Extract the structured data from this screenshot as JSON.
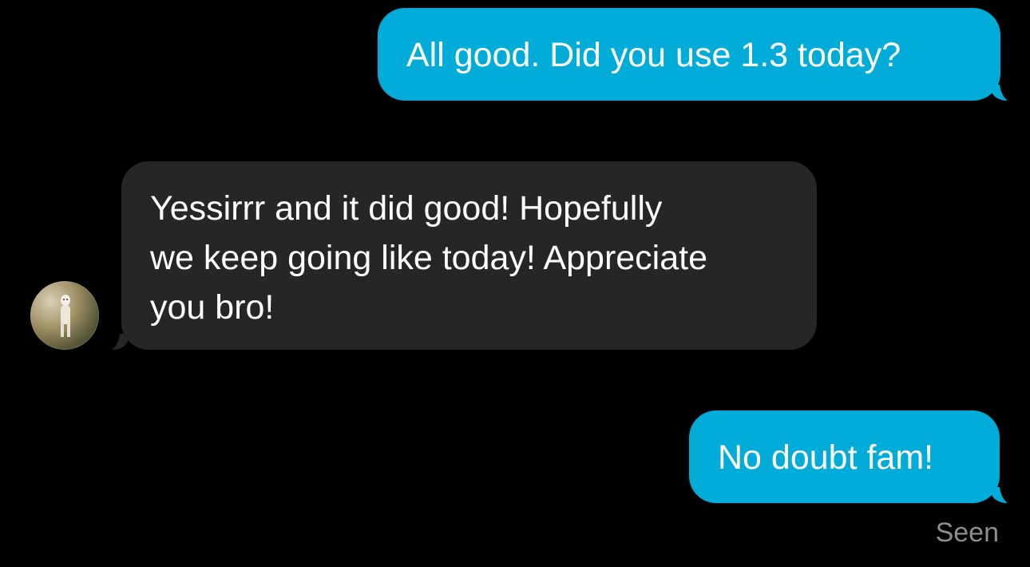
{
  "thread": {
    "messages": [
      {
        "direction": "sent",
        "text": "All good. Did you use 1.3 today?"
      },
      {
        "direction": "received",
        "text": "Yessirrr and it did good! Hopefully\nwe keep going like today! Appreciate\nyou bro!"
      },
      {
        "direction": "sent",
        "text": "No doubt fam!"
      }
    ],
    "read_receipt": "Seen"
  },
  "icons": {
    "sender_avatar": "dog-photo-avatar"
  },
  "colors": {
    "background": "#000000",
    "sent_bubble": "#01ADD8",
    "received_bubble": "#262626",
    "message_text": "#ffffff",
    "read_receipt_text": "#8e8e8e"
  }
}
